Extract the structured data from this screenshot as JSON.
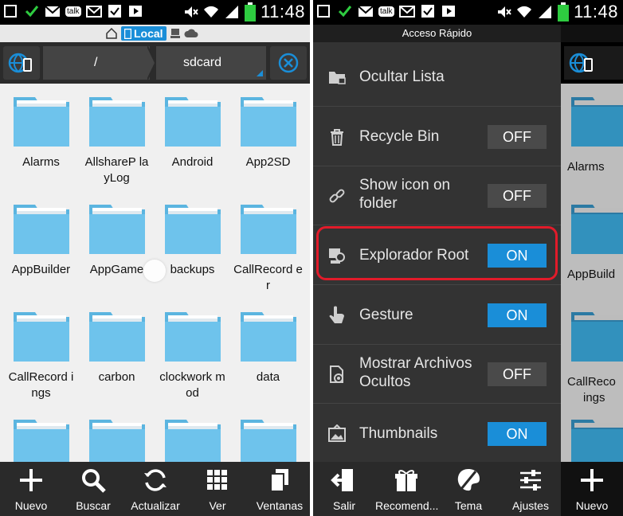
{
  "status_bar": {
    "time": "11:48",
    "talk_label": "talk"
  },
  "left": {
    "location": {
      "label": "Local"
    },
    "path": {
      "root": "/",
      "current": "sdcard"
    },
    "folders": [
      {
        "name": "Alarms"
      },
      {
        "name": "AllshareP layLog"
      },
      {
        "name": "Android"
      },
      {
        "name": "App2SD"
      },
      {
        "name": "AppBuilder"
      },
      {
        "name": "AppGame"
      },
      {
        "name": "backups"
      },
      {
        "name": "CallRecord er"
      },
      {
        "name": "CallRecord ings"
      },
      {
        "name": "carbon"
      },
      {
        "name": "clockwork mod"
      },
      {
        "name": "data"
      }
    ],
    "toolbar": [
      {
        "label": "Nuevo",
        "icon": "plus-icon"
      },
      {
        "label": "Buscar",
        "icon": "search-icon"
      },
      {
        "label": "Actualizar",
        "icon": "refresh-icon"
      },
      {
        "label": "Ver",
        "icon": "grid-icon"
      },
      {
        "label": "Ventanas",
        "icon": "windows-icon"
      }
    ]
  },
  "right": {
    "title": "Acceso Rápido",
    "items": [
      {
        "label": "Ocultar Lista",
        "icon": "folder-lock-icon",
        "toggle": ""
      },
      {
        "label": "Recycle Bin",
        "icon": "trash-icon",
        "toggle": "OFF"
      },
      {
        "label": "Show icon on folder",
        "icon": "link-icon",
        "toggle": "OFF"
      },
      {
        "label": "Explorador Root",
        "icon": "root-icon",
        "toggle": "ON"
      },
      {
        "label": "Gesture",
        "icon": "hand-icon",
        "toggle": "ON"
      },
      {
        "label": "Mostrar Archivos Ocultos",
        "icon": "hidden-files-icon",
        "toggle": "OFF"
      },
      {
        "label": "Thumbnails",
        "icon": "image-icon",
        "toggle": "ON"
      }
    ],
    "toolbar": [
      {
        "label": "Salir",
        "icon": "exit-icon"
      },
      {
        "label": "Recomend...",
        "icon": "gift-icon"
      },
      {
        "label": "Tema",
        "icon": "palette-icon"
      },
      {
        "label": "Ajustes",
        "icon": "sliders-icon"
      }
    ],
    "side_peek": {
      "labels": [
        "Alarms",
        "AppBuild",
        "CallReco",
        "ings"
      ],
      "button": "Nuevo"
    }
  },
  "colors": {
    "accent": "#1a8ed8",
    "highlight": "#e21b2a",
    "folder": "#6ec3ec"
  }
}
